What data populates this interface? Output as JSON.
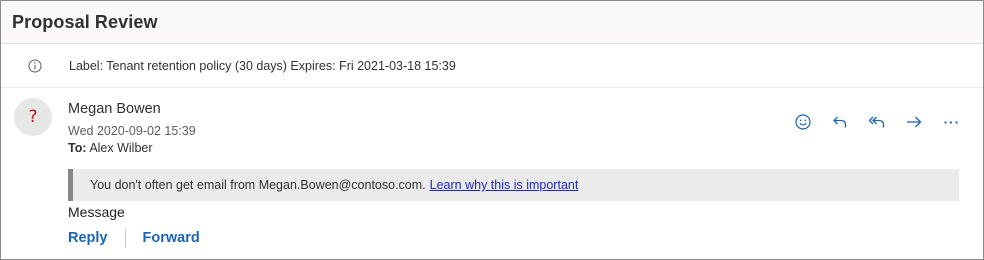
{
  "header": {
    "subject": "Proposal Review"
  },
  "label": {
    "icon": "info-icon",
    "text": "Label: Tenant retention policy (30 days) Expires: Fri 2021-03-18 15:39"
  },
  "message": {
    "avatar_text": "?",
    "sender": "Megan Bowen",
    "date": "Wed 2020-09-02 15:39",
    "to_label": "To:",
    "to_value": "Alex Wilber",
    "actions": [
      {
        "name": "emoji-icon"
      },
      {
        "name": "reply-icon"
      },
      {
        "name": "reply-all-icon"
      },
      {
        "name": "forward-icon"
      },
      {
        "name": "more-icon"
      }
    ],
    "warning": {
      "text": "You don't often get email from Megan.Bowen@contoso.com.",
      "link": "Learn why this is important"
    },
    "body": "Message",
    "reply_label": "Reply",
    "forward_label": "Forward"
  },
  "colors": {
    "accent": "#1a64b8",
    "warning_link": "#1f25c9",
    "avatar_mark": "#c50f1f"
  }
}
